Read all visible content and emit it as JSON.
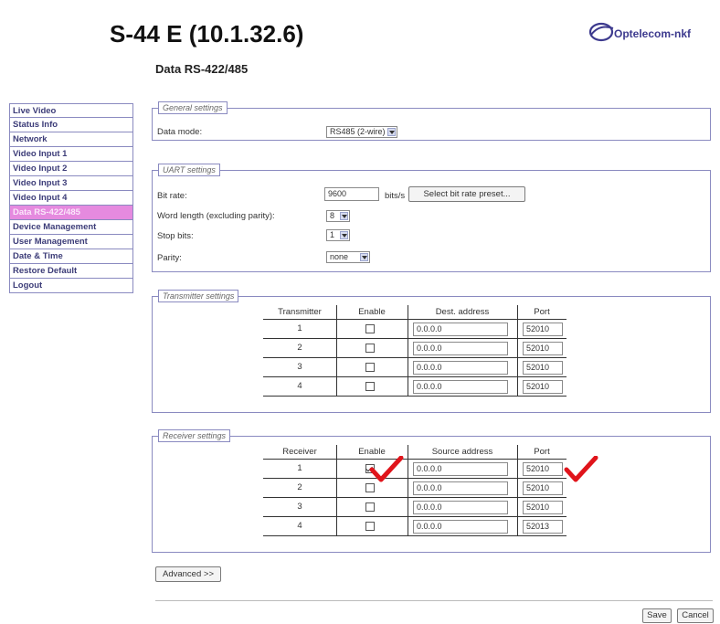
{
  "device_title": "S-44 E (10.1.32.6)",
  "logo_text": "Optelecom-nkf",
  "page_heading": "Data RS-422/485",
  "sidebar": {
    "items": [
      {
        "label": "Live Video"
      },
      {
        "label": "Status Info"
      },
      {
        "label": "Network"
      },
      {
        "label": "Video Input 1"
      },
      {
        "label": "Video Input 2"
      },
      {
        "label": "Video Input 3"
      },
      {
        "label": "Video Input 4"
      },
      {
        "label": "Data RS-422/485",
        "active": true
      },
      {
        "label": "Device Management"
      },
      {
        "label": "User Management"
      },
      {
        "label": "Date & Time"
      },
      {
        "label": "Restore Default"
      },
      {
        "label": "Logout"
      }
    ]
  },
  "general": {
    "legend": "General settings",
    "data_mode_label": "Data mode:",
    "data_mode_value": "RS485 (2-wire)"
  },
  "uart": {
    "legend": "UART settings",
    "bit_rate_label": "Bit rate:",
    "bit_rate_value": "9600",
    "bit_rate_unit": "bits/s",
    "preset_button": "Select bit rate preset...",
    "word_length_label": "Word length (excluding parity):",
    "word_length_value": "8",
    "stop_bits_label": "Stop bits:",
    "stop_bits_value": "1",
    "parity_label": "Parity:",
    "parity_value": "none"
  },
  "transmitter": {
    "legend": "Transmitter settings",
    "headers": [
      "Transmitter",
      "Enable",
      "Dest. address",
      "Port"
    ],
    "rows": [
      {
        "num": "1",
        "enabled": false,
        "address": "0.0.0.0",
        "port": "52010"
      },
      {
        "num": "2",
        "enabled": false,
        "address": "0.0.0.0",
        "port": "52010"
      },
      {
        "num": "3",
        "enabled": false,
        "address": "0.0.0.0",
        "port": "52010"
      },
      {
        "num": "4",
        "enabled": false,
        "address": "0.0.0.0",
        "port": "52010"
      }
    ]
  },
  "receiver": {
    "legend": "Receiver settings",
    "headers": [
      "Receiver",
      "Enable",
      "Source address",
      "Port"
    ],
    "rows": [
      {
        "num": "1",
        "enabled": true,
        "address": "0.0.0.0",
        "port": "52010"
      },
      {
        "num": "2",
        "enabled": false,
        "address": "0.0.0.0",
        "port": "52010"
      },
      {
        "num": "3",
        "enabled": false,
        "address": "0.0.0.0",
        "port": "52010"
      },
      {
        "num": "4",
        "enabled": false,
        "address": "0.0.0.0",
        "port": "52013"
      }
    ]
  },
  "buttons": {
    "advanced": "Advanced >>",
    "save": "Save",
    "cancel": "Cancel"
  },
  "colors": {
    "nav_active_bg": "#e58adf",
    "nav_text": "#3c3c78",
    "panel_border": "#8a8ac0",
    "annotation_check": "#e0141b",
    "logo": "#3d3a8e"
  }
}
